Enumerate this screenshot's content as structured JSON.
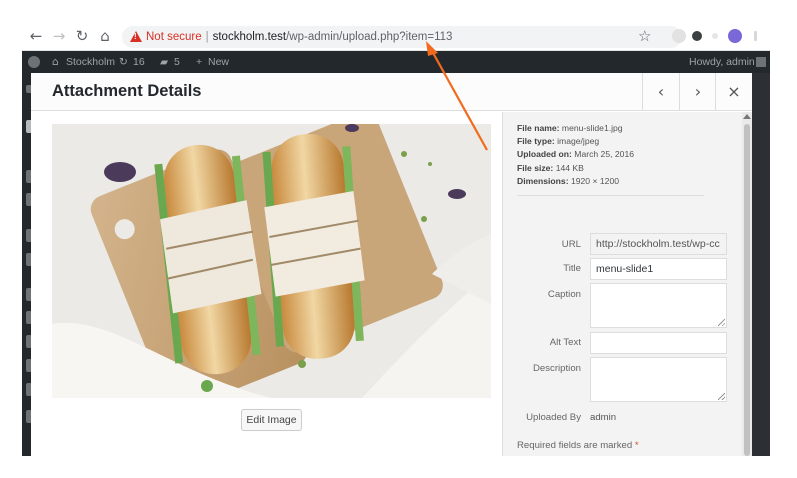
{
  "browser": {
    "back_icon": "arrow-left-icon",
    "forward_icon": "arrow-right-icon",
    "reload_icon": "reload-icon",
    "home_icon": "home-icon",
    "security_label": "Not secure",
    "url_host": "stockholm.test",
    "url_path": "/wp-admin/upload.php?item=113",
    "bookmark_icon": "star-icon"
  },
  "adminbar": {
    "site_name": "Stockholm",
    "updates_count": "16",
    "comments_count": "5",
    "new_label": "New",
    "greeting": "Howdy, admin"
  },
  "modal": {
    "title": "Attachment Details",
    "prev_icon": "chevron-left-icon",
    "next_icon": "chevron-right-icon",
    "close_icon": "close-icon",
    "edit_image_label": "Edit Image"
  },
  "file_info": {
    "name_label": "File name:",
    "name_value": "menu-slide1.jpg",
    "type_label": "File type:",
    "type_value": "image/jpeg",
    "uploaded_label": "Uploaded on:",
    "uploaded_value": "March 25, 2016",
    "size_label": "File size:",
    "size_value": "144 KB",
    "dimensions_label": "Dimensions:",
    "dimensions_value": "1920 × 1200"
  },
  "fields": {
    "url_label": "URL",
    "url_value": "http://stockholm.test/wp-cc",
    "title_label": "Title",
    "title_value": "menu-slide1",
    "caption_label": "Caption",
    "caption_value": "",
    "alt_label": "Alt Text",
    "alt_value": "",
    "description_label": "Description",
    "description_value": "",
    "uploaded_by_label": "Uploaded By",
    "uploaded_by_value": "admin",
    "required_note": "Required fields are marked",
    "required_star": "*"
  },
  "colors": {
    "admin_bar": "#23282d",
    "not_secure": "#d93025",
    "annotation_arrow": "#f26b1d"
  }
}
